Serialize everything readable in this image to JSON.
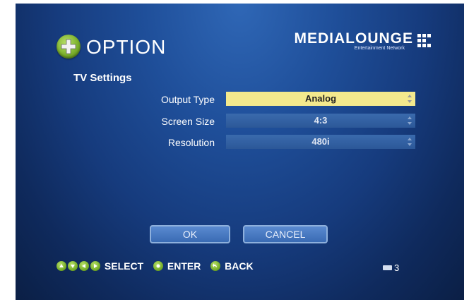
{
  "header": {
    "title": "OPTION",
    "brand_name": "MEDIALOUNGE",
    "brand_tagline": "Entertainment Network"
  },
  "section": {
    "title": "TV Settings"
  },
  "settings": [
    {
      "label": "Output Type",
      "value": "Analog",
      "focused": true
    },
    {
      "label": "Screen Size",
      "value": "4:3",
      "focused": false
    },
    {
      "label": "Resolution",
      "value": "480i",
      "focused": false
    }
  ],
  "buttons": {
    "ok": "OK",
    "cancel": "CANCEL"
  },
  "footer": {
    "select": "SELECT",
    "enter": "ENTER",
    "back": "BACK"
  },
  "status": {
    "battery_value": "3"
  },
  "colors": {
    "focus_field": "#f3e98d",
    "accent_green": "#7db22d",
    "background_blue": "#163b7d"
  }
}
